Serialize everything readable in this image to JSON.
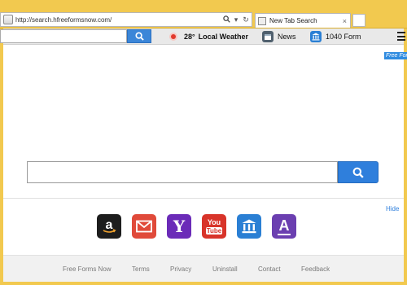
{
  "browser": {
    "address_url": "http://search.hfreeformsnow.com/",
    "tab_title": "New Tab Search",
    "tab_close": "×"
  },
  "toolbar": {
    "search_value": "",
    "weather_temp": "28°",
    "weather_label": "Local Weather",
    "news_label": "News",
    "form_label": "1040 Form"
  },
  "badge": {
    "free_forms": "Free Forms Now"
  },
  "main": {
    "search_value": "",
    "hide_label": "Hide"
  },
  "shortcuts": [
    {
      "name": "amazon",
      "icon": "amazon-icon",
      "glyph": "a",
      "color": "#1d1d1d"
    },
    {
      "name": "mail",
      "icon": "mail-icon",
      "color": "#e04a3a"
    },
    {
      "name": "yahoo",
      "icon": "yahoo-icon",
      "glyph": "Y",
      "color": "#6b2bb8"
    },
    {
      "name": "youtube",
      "icon": "youtube-icon",
      "glyph_top": "You",
      "glyph_bottom": "Tube",
      "color": "#d8342a"
    },
    {
      "name": "bank",
      "icon": "bank-icon",
      "color": "#2a7fd4"
    },
    {
      "name": "dictionary",
      "icon": "dictionary-icon",
      "glyph": "A",
      "color": "#6b3fb0"
    }
  ],
  "footer": {
    "links": [
      "Free Forms Now",
      "Terms",
      "Privacy",
      "Uninstall",
      "Contact",
      "Feedback"
    ]
  },
  "colors": {
    "frame": "#f2c94f",
    "accent_blue": "#2f7fdc"
  }
}
